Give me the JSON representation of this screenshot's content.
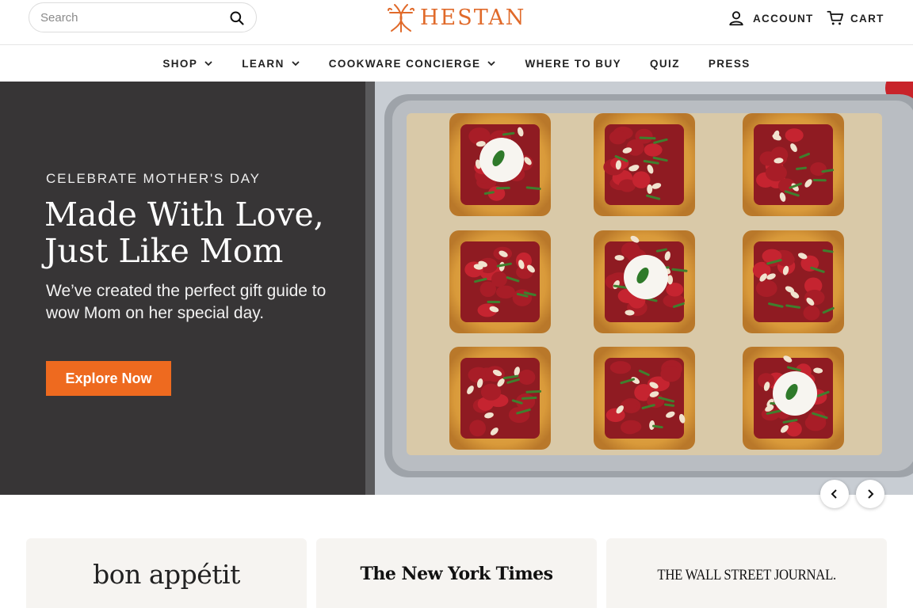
{
  "header": {
    "search_placeholder": "Search",
    "brand": "HESTAN",
    "account_label": "ACCOUNT",
    "cart_label": "CART",
    "brand_color": "#e06a2a"
  },
  "nav": {
    "items": [
      {
        "label": "SHOP",
        "has_dropdown": true
      },
      {
        "label": "LEARN",
        "has_dropdown": true
      },
      {
        "label": "COOKWARE CONCIERGE",
        "has_dropdown": true
      },
      {
        "label": "WHERE TO BUY",
        "has_dropdown": false
      },
      {
        "label": "QUIZ",
        "has_dropdown": false
      },
      {
        "label": "PRESS",
        "has_dropdown": false
      }
    ]
  },
  "hero": {
    "eyebrow": "CELEBRATE MOTHER'S DAY",
    "headline": "Made With Love, Just Like Mom",
    "subtext": "We’ve created the perfect gift guide to wow Mom on her special day.",
    "cta_label": "Explore Now",
    "cta_color": "#ee6a1f",
    "panel_color": "#373536"
  },
  "carousel": {
    "prev_icon": "chevron-left-icon",
    "next_icon": "chevron-right-icon"
  },
  "press": {
    "logos": [
      "bon appétit",
      "The New York Times",
      "THE WALL STREET JOURNAL."
    ]
  }
}
